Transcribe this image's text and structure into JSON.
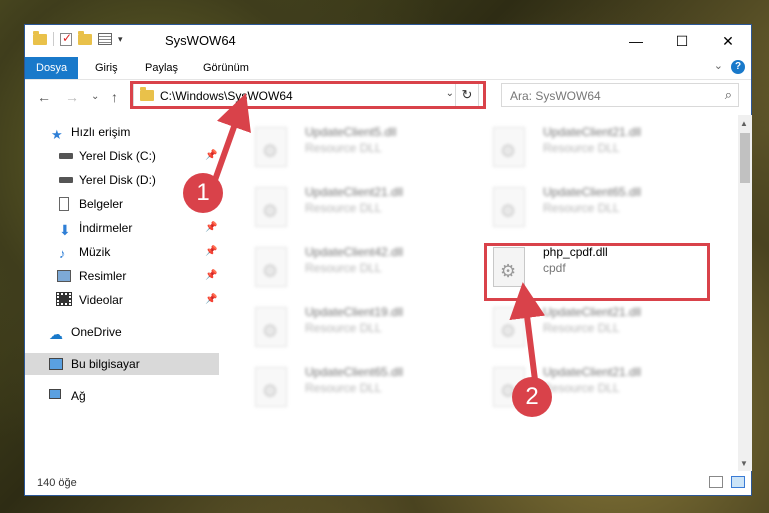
{
  "window": {
    "title": "SysWOW64",
    "minimize": "—",
    "maximize": "☐",
    "close": "✕"
  },
  "ribbon": {
    "tabs": [
      "Dosya",
      "Giriş",
      "Paylaş",
      "Görünüm"
    ],
    "help": "?",
    "collapse": "⌄"
  },
  "navbar": {
    "back": "←",
    "forward": "→",
    "recent": "⌄",
    "up": "↑",
    "address": "C:\\Windows\\SysWOW64",
    "address_dropdown": "⌄",
    "refresh": "↻",
    "search_placeholder": "Ara: SysWOW64",
    "search_icon": "⌕"
  },
  "sidebar": {
    "pin": "📌",
    "items": [
      {
        "label": "Hızlı erişim",
        "icon": "star-icon"
      },
      {
        "label": "Yerel Disk (C:)",
        "icon": "drive-icon"
      },
      {
        "label": "Yerel Disk (D:)",
        "icon": "drive-icon"
      },
      {
        "label": "Belgeler",
        "icon": "documents-icon"
      },
      {
        "label": "İndirmeler",
        "icon": "download-icon"
      },
      {
        "label": "Müzik",
        "icon": "music-icon"
      },
      {
        "label": "Resimler",
        "icon": "pictures-icon"
      },
      {
        "label": "Videolar",
        "icon": "video-icon"
      },
      {
        "label": "OneDrive",
        "icon": "cloud-icon"
      },
      {
        "label": "Bu bilgisayar",
        "icon": "computer-icon"
      },
      {
        "label": "Ağ",
        "icon": "network-icon"
      }
    ]
  },
  "files": [
    {
      "name": "UpdateClient5.dll",
      "desc": "Resource DLL"
    },
    {
      "name": "UpdateClient21.dll",
      "desc": "Resource DLL"
    },
    {
      "name": "UpdateClient21.dll",
      "desc": "Resource DLL"
    },
    {
      "name": "UpdateClient65.dll",
      "desc": "Resource DLL"
    },
    {
      "name": "UpdateClient42.dll",
      "desc": "Resource DLL"
    },
    {
      "name": "php_cpdf.dll",
      "desc": "cpdf"
    },
    {
      "name": "UpdateClient19.dll",
      "desc": "Resource DLL"
    },
    {
      "name": "UpdateClient21.dll",
      "desc": "Resource DLL"
    },
    {
      "name": "UpdateClient65.dll",
      "desc": "Resource DLL"
    },
    {
      "name": "UpdateClient21.dll",
      "desc": "Resource DLL"
    }
  ],
  "status": {
    "count": "140 öğe"
  },
  "markers": {
    "one": "1",
    "two": "2"
  },
  "colors": {
    "accent": "#1979ca",
    "highlight": "#d9424a"
  }
}
